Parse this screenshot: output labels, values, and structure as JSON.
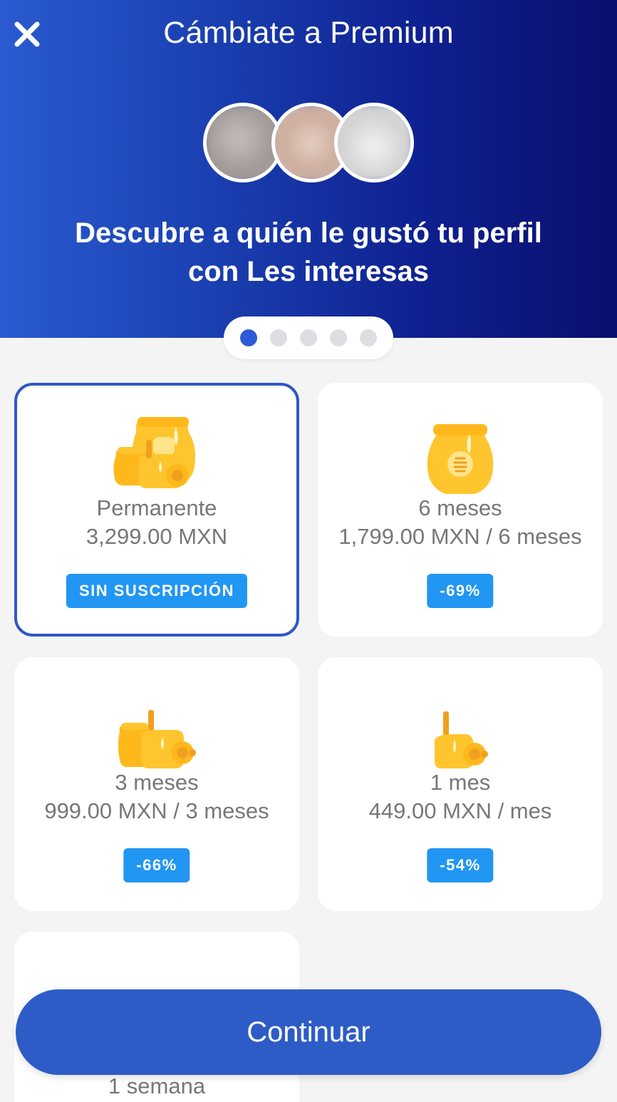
{
  "header": {
    "title": "Cámbiate a Premium",
    "headline": "Descubre a quién le gustó tu perfil con Les interesas",
    "close_icon": "close-icon"
  },
  "carousel": {
    "page_count": 5,
    "active_index": 0
  },
  "plans": [
    {
      "name": "Permanente",
      "price": "3,299.00 MXN",
      "badge": "SIN SUSCRIPCIÓN",
      "selected": true,
      "icon": "honey-pots-large-icon"
    },
    {
      "name": "6 meses",
      "price": "1,799.00 MXN / 6 meses",
      "badge": "-69%",
      "selected": false,
      "icon": "honey-jar-icon"
    },
    {
      "name": "3 meses",
      "price": "999.00 MXN / 3 meses",
      "badge": "-66%",
      "selected": false,
      "icon": "honey-pots-medium-icon"
    },
    {
      "name": "1 mes",
      "price": "449.00 MXN / mes",
      "badge": "-54%",
      "selected": false,
      "icon": "honey-pot-small-icon"
    },
    {
      "name": "1 semana",
      "icon": "honey-week-icon"
    }
  ],
  "continue_label": "Continuar",
  "colors": {
    "primary": "#2e5cc7",
    "badge": "#2196f3",
    "honey": "#ffc52e",
    "header_gradient_start": "#2a5bd0",
    "header_gradient_end": "#0a0f6e"
  }
}
